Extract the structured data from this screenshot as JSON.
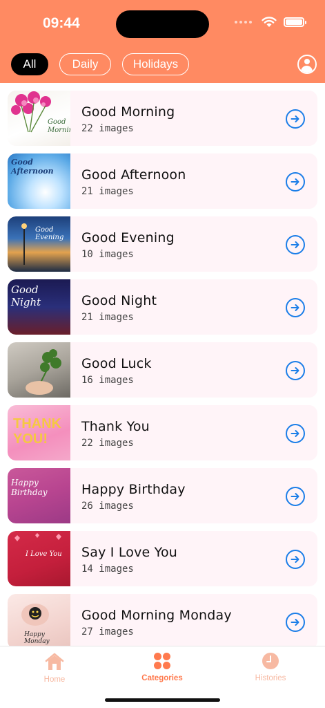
{
  "status_bar": {
    "time": "09:44"
  },
  "filters": [
    {
      "label": "All",
      "active": true
    },
    {
      "label": "Daily",
      "active": false
    },
    {
      "label": "Holidays",
      "active": false
    }
  ],
  "categories": [
    {
      "title": "Good Morning",
      "count": "22 images",
      "thumb_caption": "Good Morning"
    },
    {
      "title": "Good Afternoon",
      "count": "21 images",
      "thumb_caption": "Good Afternoon"
    },
    {
      "title": "Good Evening",
      "count": "10 images",
      "thumb_caption": "Good Evening"
    },
    {
      "title": "Good Night",
      "count": "21 images",
      "thumb_caption": "Good Night"
    },
    {
      "title": "Good Luck",
      "count": "16 images",
      "thumb_caption": ""
    },
    {
      "title": "Thank You",
      "count": "22 images",
      "thumb_caption": "THANK YOU!"
    },
    {
      "title": "Happy Birthday",
      "count": "26 images",
      "thumb_caption": "Happy Birthday"
    },
    {
      "title": "Say I Love You",
      "count": "14 images",
      "thumb_caption": "I Love You"
    },
    {
      "title": "Good Morning Monday",
      "count": "27 images",
      "thumb_caption": "Happy Monday"
    }
  ],
  "tabs": [
    {
      "label": "Home",
      "icon": "house-icon"
    },
    {
      "label": "Categories",
      "icon": "grid-circles-icon"
    },
    {
      "label": "Histories",
      "icon": "clock-icon"
    }
  ],
  "colors": {
    "header": "#ff8a62",
    "card": "#fff4f8",
    "accent_blue": "#1b7ee8",
    "tab_active": "#ff7a4e",
    "tab_inactive": "#f7b9a2"
  }
}
